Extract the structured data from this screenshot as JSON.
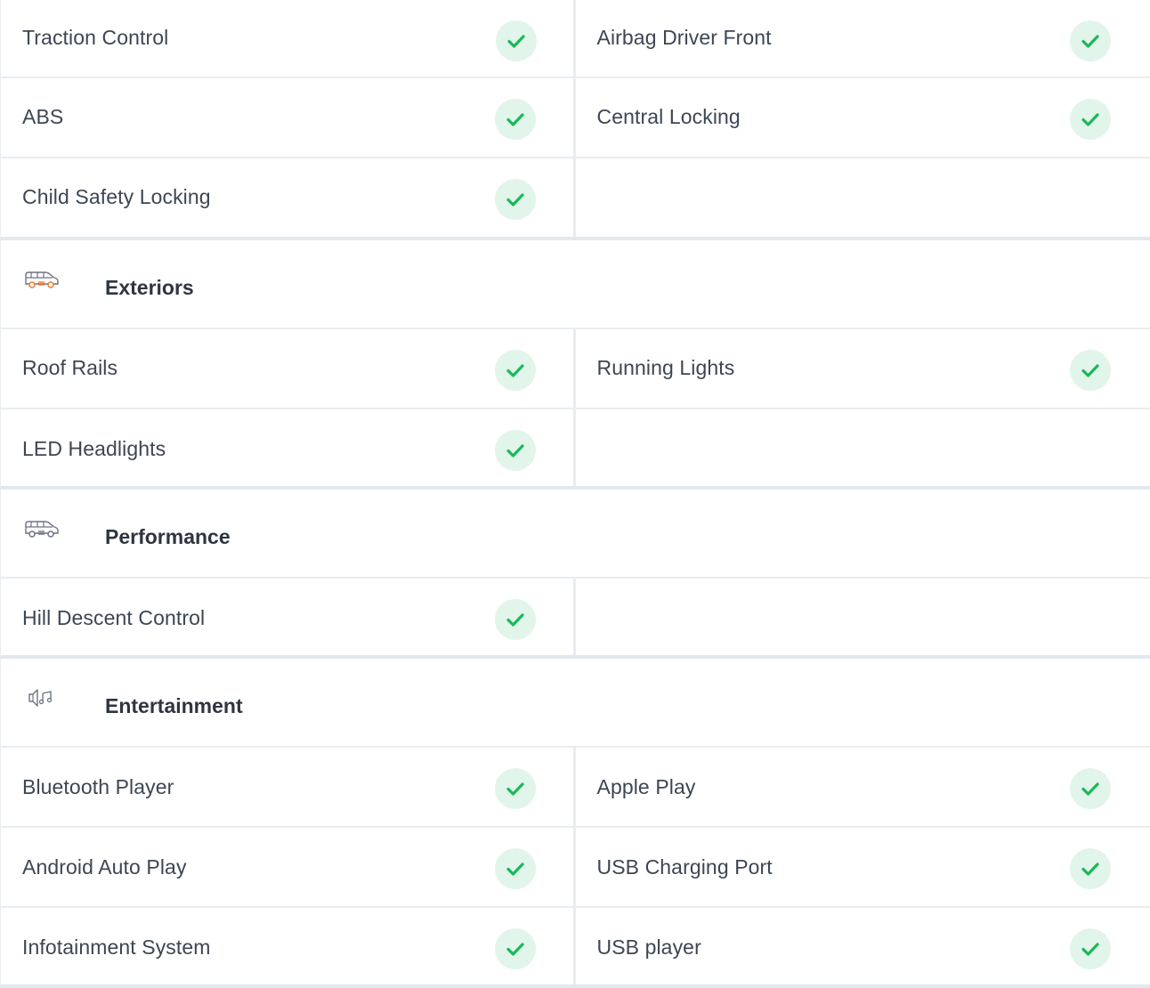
{
  "colors": {
    "check_bg": "#e2f5ea",
    "check_mark": "#19b95a",
    "icon_orange": "#f07a2a",
    "icon_gray": "#6d7480",
    "divider": "#e9edf1"
  },
  "top_rows": [
    {
      "left": "Traction Control",
      "right": "Airbag Driver Front"
    },
    {
      "left": "ABS",
      "right": "Central Locking"
    },
    {
      "left": "Child Safety Locking",
      "right": ""
    }
  ],
  "sections": [
    {
      "title": "Exteriors",
      "icon": "car-icon",
      "rows": [
        {
          "left": "Roof Rails",
          "right": "Running Lights"
        },
        {
          "left": "LED Headlights",
          "right": ""
        }
      ]
    },
    {
      "title": "Performance",
      "icon": "car-icon",
      "rows": [
        {
          "left": "Hill Descent Control",
          "right": ""
        }
      ]
    },
    {
      "title": "Entertainment",
      "icon": "speaker-music-icon",
      "rows": [
        {
          "left": "Bluetooth Player",
          "right": "Apple Play"
        },
        {
          "left": "Android Auto Play",
          "right": "USB Charging Port"
        },
        {
          "left": "Infotainment System",
          "right": "USB player"
        }
      ]
    }
  ]
}
